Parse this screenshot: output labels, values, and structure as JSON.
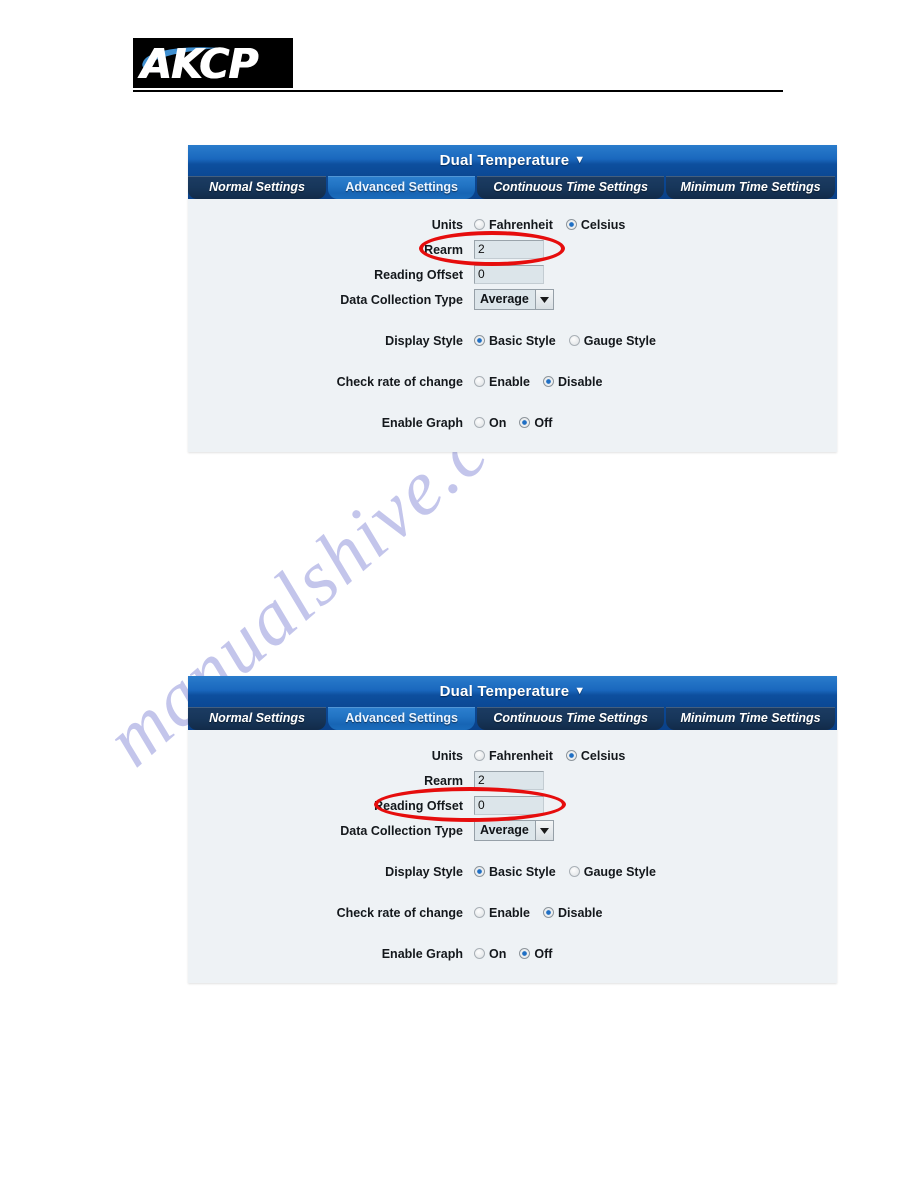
{
  "brand": {
    "logo_text": "AKCP",
    "logo_alt": "AKCP logo"
  },
  "panels": [
    {
      "title": "Dual Temperature",
      "title_caret": "▼",
      "tabs": [
        {
          "label": "Normal Settings",
          "active": false
        },
        {
          "label": "Advanced Settings",
          "active": true
        },
        {
          "label": "Continuous Time Settings",
          "active": false
        },
        {
          "label": "Minimum Time Settings",
          "active": false
        }
      ],
      "fields": {
        "units_label": "Units",
        "units_options": [
          {
            "label": "Fahrenheit",
            "selected": false
          },
          {
            "label": "Celsius",
            "selected": true
          }
        ],
        "rearm_label": "Rearm",
        "rearm_value": "2",
        "reading_offset_label": "Reading Offset",
        "reading_offset_value": "0",
        "data_collection_label": "Data Collection Type",
        "data_collection_value": "Average",
        "display_style_label": "Display Style",
        "display_style_options": [
          {
            "label": "Basic Style",
            "selected": true
          },
          {
            "label": "Gauge Style",
            "selected": false
          }
        ],
        "check_rate_label": "Check rate of change",
        "check_rate_options": [
          {
            "label": "Enable",
            "selected": false
          },
          {
            "label": "Disable",
            "selected": true
          }
        ],
        "enable_graph_label": "Enable Graph",
        "enable_graph_options": [
          {
            "label": "On",
            "selected": false
          },
          {
            "label": "Off",
            "selected": true
          }
        ]
      },
      "annotation": {
        "target": "Rearm",
        "color": "#e60d0d"
      }
    },
    {
      "title": "Dual Temperature",
      "title_caret": "▼",
      "tabs": [
        {
          "label": "Normal Settings",
          "active": false
        },
        {
          "label": "Advanced Settings",
          "active": true
        },
        {
          "label": "Continuous Time Settings",
          "active": false
        },
        {
          "label": "Minimum Time Settings",
          "active": false
        }
      ],
      "fields": {
        "units_label": "Units",
        "units_options": [
          {
            "label": "Fahrenheit",
            "selected": false
          },
          {
            "label": "Celsius",
            "selected": true
          }
        ],
        "rearm_label": "Rearm",
        "rearm_value": "2",
        "reading_offset_label": "Reading Offset",
        "reading_offset_value": "0",
        "data_collection_label": "Data Collection Type",
        "data_collection_value": "Average",
        "display_style_label": "Display Style",
        "display_style_options": [
          {
            "label": "Basic Style",
            "selected": true
          },
          {
            "label": "Gauge Style",
            "selected": false
          }
        ],
        "check_rate_label": "Check rate of change",
        "check_rate_options": [
          {
            "label": "Enable",
            "selected": false
          },
          {
            "label": "Disable",
            "selected": true
          }
        ],
        "enable_graph_label": "Enable Graph",
        "enable_graph_options": [
          {
            "label": "On",
            "selected": false
          },
          {
            "label": "Off",
            "selected": true
          }
        ]
      },
      "annotation": {
        "target": "Reading Offset",
        "color": "#e60d0d"
      }
    }
  ],
  "watermark": {
    "text": "manualshive.com",
    "color": "#b9bbe8"
  }
}
